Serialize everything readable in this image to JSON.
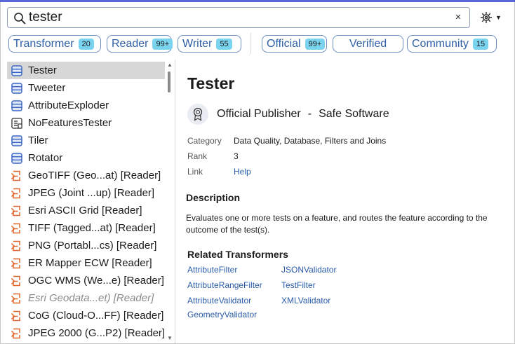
{
  "search": {
    "value": "tester",
    "clear_label": "×"
  },
  "filters": [
    {
      "label": "Transformer",
      "count": "20"
    },
    {
      "label": "Reader",
      "count": "99+"
    },
    {
      "label": "Writer",
      "count": "55"
    },
    {
      "label": "Official",
      "count": "99+"
    },
    {
      "label": "Verified",
      "count": ""
    },
    {
      "label": "Community",
      "count": "15"
    }
  ],
  "results": [
    {
      "label": "Tester",
      "kind": "transformer",
      "selected": true
    },
    {
      "label": "Tweeter",
      "kind": "transformer"
    },
    {
      "label": "AttributeExploder",
      "kind": "transformer"
    },
    {
      "label": "NoFeaturesTester",
      "kind": "transformer-special"
    },
    {
      "label": "Tiler",
      "kind": "transformer"
    },
    {
      "label": "Rotator",
      "kind": "transformer"
    },
    {
      "label": "GeoTIFF (Geo...at) [Reader]",
      "kind": "reader"
    },
    {
      "label": "JPEG (Joint ...up) [Reader]",
      "kind": "reader"
    },
    {
      "label": "Esri ASCII Grid [Reader]",
      "kind": "reader"
    },
    {
      "label": "TIFF (Tagged...at) [Reader]",
      "kind": "reader"
    },
    {
      "label": "PNG (Portabl...cs) [Reader]",
      "kind": "reader"
    },
    {
      "label": "ER Mapper ECW [Reader]",
      "kind": "reader"
    },
    {
      "label": "OGC WMS (We...e) [Reader]",
      "kind": "reader"
    },
    {
      "label": "Esri Geodata...et) [Reader]",
      "kind": "reader",
      "dim": true
    },
    {
      "label": "CoG (Cloud-O...FF) [Reader]",
      "kind": "reader"
    },
    {
      "label": "JPEG 2000 (G...P2) [Reader]",
      "kind": "reader"
    }
  ],
  "detail": {
    "title": "Tester",
    "publisher_type": "Official Publisher",
    "publisher_sep": "-",
    "publisher_name": "Safe Software",
    "meta": [
      {
        "key": "Category",
        "value": "Data Quality, Database, Filters and Joins",
        "link": false
      },
      {
        "key": "Rank",
        "value": "3",
        "link": false
      },
      {
        "key": "Link",
        "value": "Help",
        "link": true
      }
    ],
    "description_heading": "Description",
    "description": "Evaluates one or more tests on a feature, and routes the feature according to the outcome of the test(s).",
    "related_heading": "Related Transformers",
    "related_col1": [
      "AttributeFilter",
      "AttributeRangeFilter",
      "AttributeValidator",
      "GeometryValidator"
    ],
    "related_col2": [
      "JSONValidator",
      "TestFilter",
      "XMLValidator"
    ]
  },
  "colors": {
    "accent": "#5b67d8",
    "chip_border": "#6f8ec0",
    "chip_text": "#2f5fa6",
    "badge": "#7ad4ef",
    "link": "#2a5ca8",
    "transformer_icon": "#3b66c4",
    "reader_icon": "#e0662b"
  },
  "icons": {
    "search": "search-icon",
    "clear": "close-icon",
    "settings": "gear-icon",
    "publisher": "award-ribbon-icon"
  }
}
